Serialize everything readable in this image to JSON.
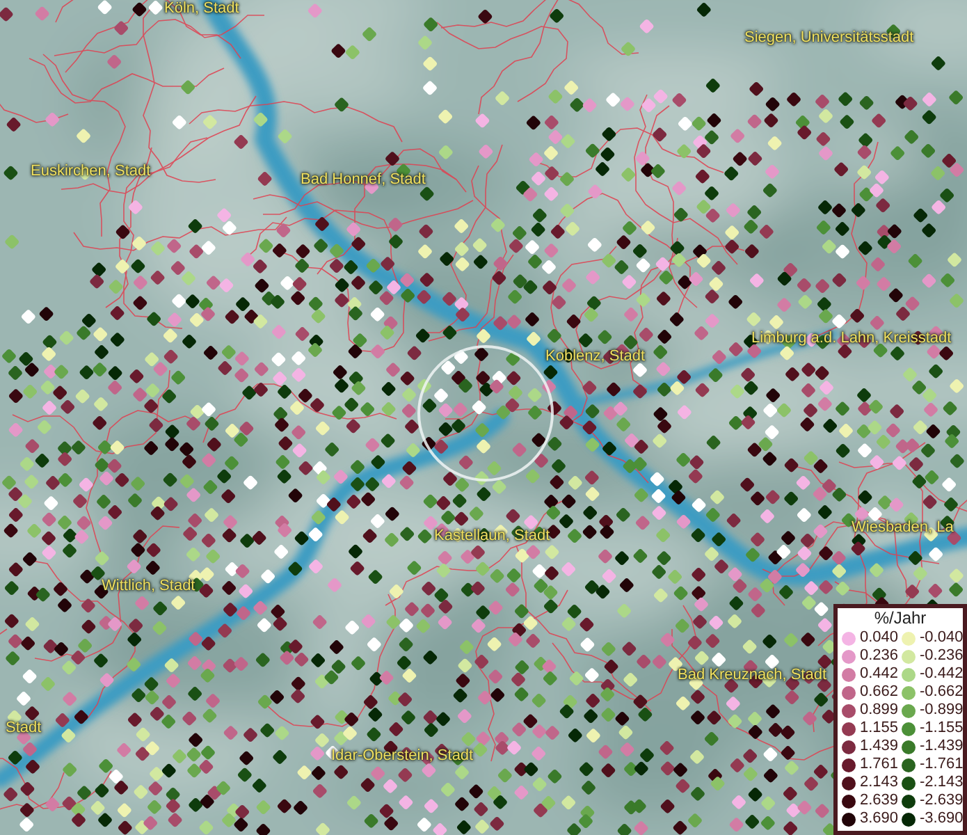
{
  "map": {
    "places": [
      {
        "label": "Köln, Stadt"
      },
      {
        "label": "Siegen, Universitätsstadt"
      },
      {
        "label": "Euskirchen, Stadt"
      },
      {
        "label": "Bad Honnef, Stadt"
      },
      {
        "label": "Koblenz, Stadt"
      },
      {
        "label": "Limburg a.d. Lahn, Kreisstadt"
      },
      {
        "label": "Wiesbaden, La"
      },
      {
        "label": "Kastellaun, Stadt"
      },
      {
        "label": "Wittlich, Stadt"
      },
      {
        "label": "Bad Kreuznach, Stadt"
      },
      {
        "label": "Stadt"
      },
      {
        "label": "Idar-Oberstein, Stadt"
      }
    ]
  },
  "legend": {
    "title": "%/Jahr",
    "items": [
      {
        "label": "0.040",
        "color": "#f4b4e4"
      },
      {
        "label": "-0.040",
        "color": "#eef2b0"
      },
      {
        "label": "0.236",
        "color": "#e498c8"
      },
      {
        "label": "-0.236",
        "color": "#d2e8a0"
      },
      {
        "label": "0.442",
        "color": "#d27ca4"
      },
      {
        "label": "-0.442",
        "color": "#acd888"
      },
      {
        "label": "0.662",
        "color": "#c0668a"
      },
      {
        "label": "-0.662",
        "color": "#8cc268"
      },
      {
        "label": "0.899",
        "color": "#a84c6a"
      },
      {
        "label": "-0.899",
        "color": "#6aa84e"
      },
      {
        "label": "1.155",
        "color": "#943a52"
      },
      {
        "label": "-1.155",
        "color": "#4c9038"
      },
      {
        "label": "1.439",
        "color": "#7c2a40"
      },
      {
        "label": "-1.439",
        "color": "#3a7a2a"
      },
      {
        "label": "1.761",
        "color": "#681a2c"
      },
      {
        "label": "-1.761",
        "color": "#2a6420"
      },
      {
        "label": "2.143",
        "color": "#50101c"
      },
      {
        "label": "-2.143",
        "color": "#1a5014"
      },
      {
        "label": "2.639",
        "color": "#3a0810"
      },
      {
        "label": "-2.639",
        "color": "#0e3c0c"
      },
      {
        "label": "3.690",
        "color": "#220408"
      },
      {
        "label": "-3.690",
        "color": "#062806"
      }
    ]
  }
}
